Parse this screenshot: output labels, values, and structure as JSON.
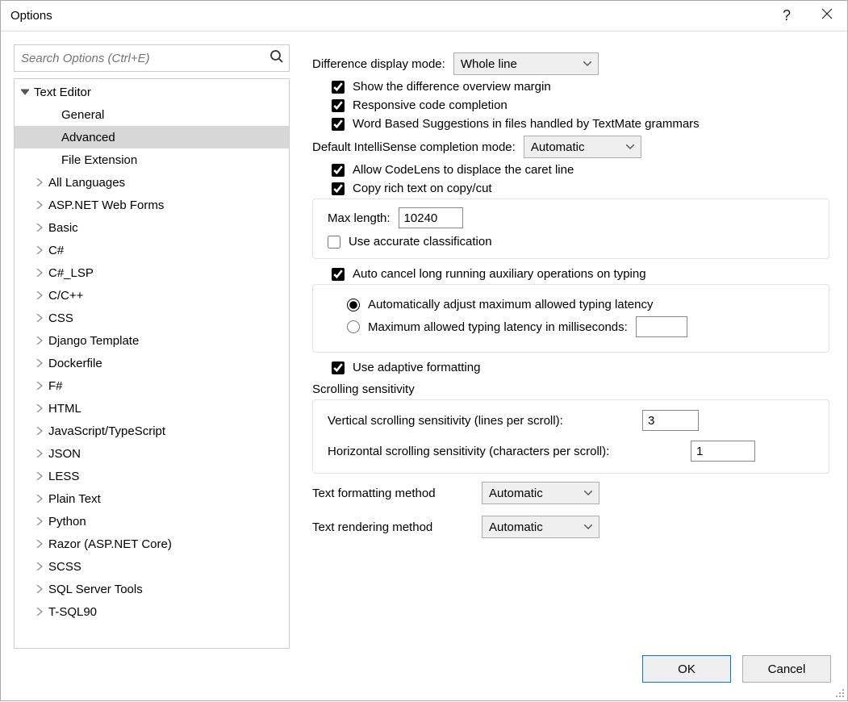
{
  "window": {
    "title": "Options"
  },
  "search": {
    "placeholder": "Search Options (Ctrl+E)"
  },
  "tree": {
    "root": "Text Editor",
    "children": [
      "General",
      "Advanced",
      "File Extension"
    ],
    "selected": "Advanced",
    "nodes": [
      "All Languages",
      "ASP.NET Web Forms",
      "Basic",
      "C#",
      "C#_LSP",
      "C/C++",
      "CSS",
      "Django Template",
      "Dockerfile",
      "F#",
      "HTML",
      "JavaScript/TypeScript",
      "JSON",
      "LESS",
      "Plain Text",
      "Python",
      "Razor (ASP.NET Core)",
      "SCSS",
      "SQL Server Tools",
      "T-SQL90"
    ]
  },
  "right": {
    "diff_mode_label": "Difference display mode:",
    "diff_mode_value": "Whole line",
    "show_diff_overview": "Show the difference overview margin",
    "responsive_completion": "Responsive code completion",
    "word_based": "Word Based Suggestions in files handled by TextMate grammars",
    "intellisense_label": "Default IntelliSense completion mode:",
    "intellisense_value": "Automatic",
    "codelens": "Allow CodeLens to displace the caret line",
    "copy_rich": "Copy rich text on copy/cut",
    "max_length_label": "Max length:",
    "max_length_value": "10240",
    "accurate_class": "Use accurate classification",
    "auto_cancel": "Auto cancel long running auxiliary operations on typing",
    "radio_auto": "Automatically adjust maximum allowed typing latency",
    "radio_max": "Maximum allowed typing latency in milliseconds:",
    "latency_value": "",
    "adaptive_fmt": "Use adaptive formatting",
    "scroll_title": "Scrolling sensitivity",
    "vscroll_label": "Vertical scrolling sensitivity (lines per scroll):",
    "vscroll_value": "3",
    "hscroll_label": "Horizontal scrolling sensitivity (characters per scroll):",
    "hscroll_value": "1",
    "fmt_method_label": "Text formatting method",
    "fmt_method_value": "Automatic",
    "render_method_label": "Text rendering method",
    "render_method_value": "Automatic"
  },
  "footer": {
    "ok": "OK",
    "cancel": "Cancel"
  }
}
